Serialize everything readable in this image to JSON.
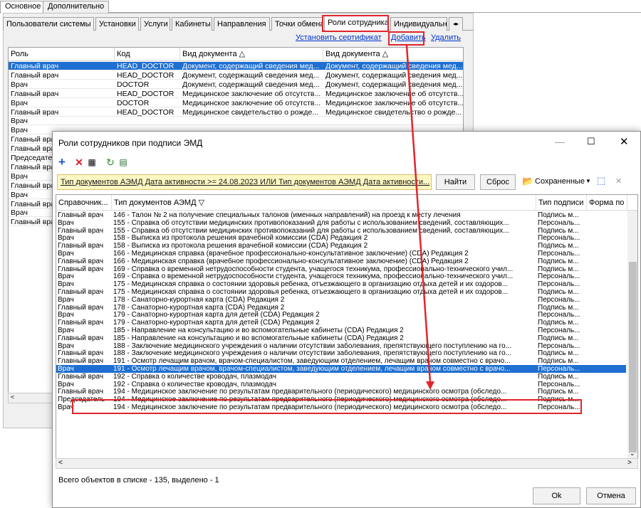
{
  "main_tabs": [
    "Основное",
    "Дополнительно"
  ],
  "sub_tabs": [
    "Пользователи системы",
    "Установки",
    "Услуги",
    "Кабинеты",
    "Направления",
    "Точки обмена",
    "Роли сотрудника",
    "Индивидуальн"
  ],
  "links": {
    "set_cert": "Установить сертификат",
    "add": "Добавить",
    "delete": "Удалить"
  },
  "grid": {
    "headers": [
      "Роль",
      "Код",
      "Вид документа △",
      "Вид документа △"
    ],
    "rows": [
      [
        "Главный врач",
        "HEAD_DOCTOR",
        "Документ, содержащий сведения мед...",
        "Документ, содержащий сведения мед..."
      ],
      [
        "Главный врач",
        "HEAD_DOCTOR",
        "Документ, содержащий сведения мед...",
        "Документ, содержащий сведения мед..."
      ],
      [
        "Врач",
        "DOCTOR",
        "Документ, содержащий сведения мед...",
        "Документ, содержащий сведения мед..."
      ],
      [
        "Главный врач",
        "HEAD_DOCTOR",
        "Медицинское заключение об отсутств...",
        "Медицинское заключение об отсутств..."
      ],
      [
        "Врач",
        "DOCTOR",
        "Медицинское заключение об отсутств...",
        "Медицинское заключение об отсутств..."
      ],
      [
        "Главный врач",
        "HEAD_DOCTOR",
        "Медицинское свидетельство о рожде...",
        "Медицинское свидетельство о рожде..."
      ],
      [
        "Врач",
        "",
        "",
        ""
      ],
      [
        "Врач",
        "",
        "",
        ""
      ],
      [
        "Главный вра",
        "",
        "",
        ""
      ],
      [
        "Главный вра",
        "",
        "",
        ""
      ],
      [
        "Председате",
        "",
        "",
        ""
      ],
      [
        "Главный вра",
        "",
        "",
        ""
      ],
      [
        "Врач",
        "",
        "",
        ""
      ],
      [
        "Главный вра",
        "",
        "",
        ""
      ],
      [
        "Врач",
        "",
        "",
        ""
      ],
      [
        "Главный вра",
        "",
        "",
        ""
      ],
      [
        "Врач",
        "",
        "",
        ""
      ],
      [
        "Главный вра",
        "",
        "",
        ""
      ]
    ]
  },
  "dialog": {
    "title": "Роли сотрудников при подписи ЭМД",
    "filter": "Тип документов АЭМД Дата активности >= 24.08.2023 ИЛИ Тип документов АЭМД Дата активности...",
    "find": "Найти",
    "reset": "Сброс",
    "saved": "Сохраненные",
    "headers": [
      "Справочник...",
      "Тип документов АЭМД ▽",
      "Тип подписи",
      "Форма по"
    ],
    "rows": [
      [
        "Главный врач",
        "146 - Талон № 2 на получение специальных талонов (именных направлений) на проезд к месту лечения",
        "Подпись м..."
      ],
      [
        "Врач",
        "155 - Справка об отсутствии медицинских противопоказаний для работы с использованием сведений, составляющих...",
        "Персональ..."
      ],
      [
        "Главный врач",
        "155 - Справка об отсутствии медицинских противопоказаний для работы с использованием сведений, составляющих...",
        "Подпись м..."
      ],
      [
        "Врач",
        "158 - Выписка из протокола решения врачебной комиссии (CDA) Редакция 2",
        "Персональ..."
      ],
      [
        "Главный врач",
        "158 - Выписка из протокола решения врачебной комиссии (CDA) Редакция 2",
        "Подпись м..."
      ],
      [
        "Врач",
        "166 - Медицинская справка (врачебное профессионально-консультативное заключение) (CDA) Редакция 2",
        "Персональ..."
      ],
      [
        "Главный врач",
        "166 - Медицинская справка (врачебное профессионально-консультативное заключение) (CDA) Редакция 2",
        "Подпись м..."
      ],
      [
        "Главный врач",
        "169 - Справка о временной нетрудоспособности студента, учащегося техникума, профессионально-технического учил...",
        "Подпись м..."
      ],
      [
        "Врач",
        "169 - Справка о временной нетрудоспособности студента, учащегося техникума, профессионально-технического учил...",
        "Персональ..."
      ],
      [
        "Врач",
        "175 - Медицинская справка о состоянии здоровья ребенка, отъезжающего в организацию отдыха детей и их оздоров...",
        "Персональ..."
      ],
      [
        "Главный врач",
        "175 - Медицинская справка о состоянии здоровья ребенка, отъезжающего в организацию отдыха детей и их оздоров...",
        "Подпись м..."
      ],
      [
        "Врач",
        "178 - Санаторно-курортная карта (CDA) Редакция 2",
        "Персональ..."
      ],
      [
        "Главный врач",
        "178 - Санаторно-курортная карта (CDA) Редакция 2",
        "Подпись м..."
      ],
      [
        "Врач",
        "179 - Санаторно-курортная карта для детей (CDA) Редакция 2",
        "Персональ..."
      ],
      [
        "Главный врач",
        "179 - Санаторно-курортная карта для детей (CDA) Редакция 2",
        "Подпись м..."
      ],
      [
        "Врач",
        "185 - Направление на консультацию и во вспомогательные кабинеты (CDA) Редакция 2",
        "Персональ..."
      ],
      [
        "Главный врач",
        "185 - Направление на консультацию и во вспомогательные кабинеты (CDA) Редакция 2",
        "Подпись м..."
      ],
      [
        "Врач",
        "188 - Заключение медицинского учреждения о наличии отсутствии заболевания, препятствующего поступлению на го...",
        "Персональ..."
      ],
      [
        "Главный врач",
        "188 - Заключение медицинского учреждения о наличии отсутствии заболевания, препятствующего поступлению на го...",
        "Подпись м..."
      ],
      [
        "Главный врач",
        "191 - Осмотр лечащим врачом, врачом-специалистом, заведующим отделением, лечащим врачом совместно с врачо...",
        "Подпись м..."
      ],
      [
        "Врач",
        "191 - Осмотр лечащим врачом, врачом-специалистом, заведующим отделением, лечащим врачом совместно с врачо...",
        "Персональ..."
      ],
      [
        "Главный врач",
        "192 - Справка о количестве кроводач, плазмодач",
        "Подпись м..."
      ],
      [
        "Врач",
        "192 - Справка о количестве кроводач, плазмодач",
        "Персональ..."
      ],
      [
        "Главный врач",
        "194 - Медицинское заключение по результатам предварительного (периодического) медицинского осмотра (обследо...",
        "Подпись м..."
      ],
      [
        "Председатель",
        "194 - Медицинское заключение по результатам предварительного (периодического) медицинского осмотра (обследо...",
        "Подпись м..."
      ],
      [
        "Врач",
        "194 - Медицинское заключение по результатам предварительного (периодического) медицинского осмотра (обследо...",
        "Персональ..."
      ]
    ],
    "selected_index": 20,
    "status": "Всего объектов в списке - 135, выделено - 1",
    "ok": "Ok",
    "cancel": "Отмена"
  },
  "colors": {
    "selection": "#1e6fd1",
    "highlight": "#e0262c",
    "filter_bg": "#fdf7c3"
  },
  "icons": [
    "add-icon",
    "delete-icon",
    "properties-icon",
    "refresh-icon",
    "export-icon",
    "folder-icon",
    "save-icon",
    "close-icon",
    "minimize-icon",
    "maximize-icon",
    "sort-icon"
  ]
}
